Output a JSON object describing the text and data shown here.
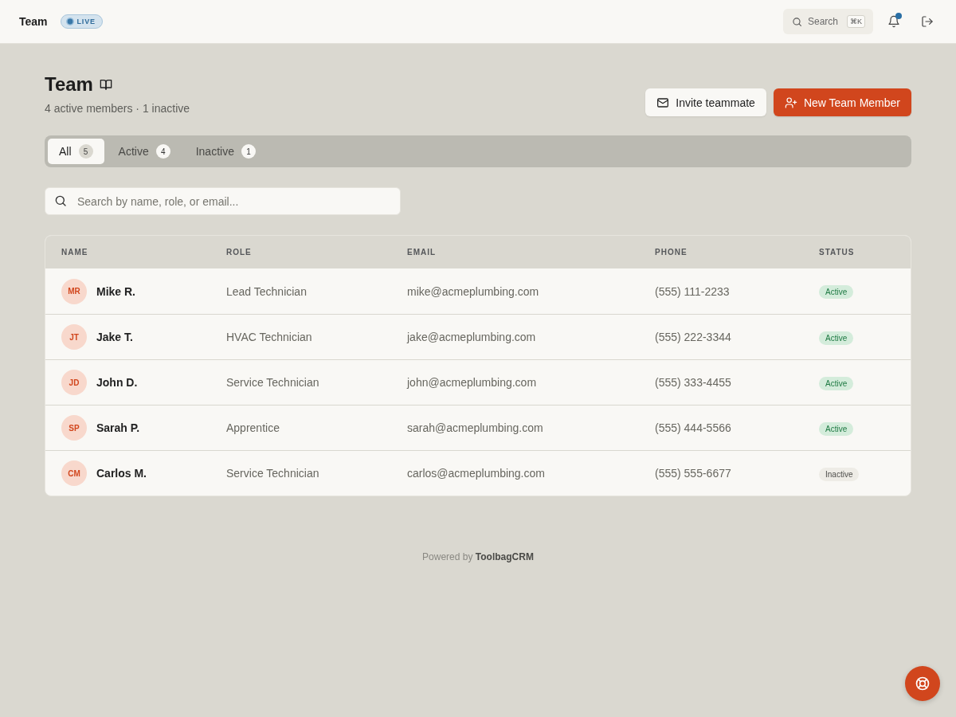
{
  "topbar": {
    "title": "Team",
    "live_badge": "LIVE",
    "search": {
      "placeholder": "Search",
      "shortcut": "⌘K"
    },
    "notifications_unread": true
  },
  "header": {
    "title": "Team",
    "subtitle": "4 active members · 1 inactive",
    "buttons": [
      {
        "label": "Invite teammate",
        "kind": "secondary"
      },
      {
        "label": "New Team Member",
        "kind": "primary"
      }
    ]
  },
  "tabs": [
    {
      "label": "All",
      "count": "5",
      "selected": true
    },
    {
      "label": "Active",
      "count": "4",
      "selected": false
    },
    {
      "label": "Inactive",
      "count": "1",
      "selected": false
    }
  ],
  "search": {
    "placeholder": "Search by name, role, or email..."
  },
  "table": {
    "columns": [
      "NAME",
      "ROLE",
      "EMAIL",
      "PHONE",
      "STATUS"
    ],
    "rows": [
      {
        "initials": "MR",
        "name": "Mike R.",
        "role": "Lead Technician",
        "email": "mike@acmeplumbing.com",
        "phone": "(555) 111-2233",
        "status": "Active",
        "active": true
      },
      {
        "initials": "JT",
        "name": "Jake T.",
        "role": "HVAC Technician",
        "email": "jake@acmeplumbing.com",
        "phone": "(555) 222-3344",
        "status": "Active",
        "active": true
      },
      {
        "initials": "JD",
        "name": "John D.",
        "role": "Service Technician",
        "email": "john@acmeplumbing.com",
        "phone": "(555) 333-4455",
        "status": "Active",
        "active": true
      },
      {
        "initials": "SP",
        "name": "Sarah P.",
        "role": "Apprentice",
        "email": "sarah@acmeplumbing.com",
        "phone": "(555) 444-5566",
        "status": "Active",
        "active": true
      },
      {
        "initials": "CM",
        "name": "Carlos M.",
        "role": "Service Technician",
        "email": "carlos@acmeplumbing.com",
        "phone": "(555) 555-6677",
        "status": "Inactive",
        "active": false
      }
    ]
  },
  "footer": {
    "text": "Powered by **ToolbagCRM**"
  }
}
